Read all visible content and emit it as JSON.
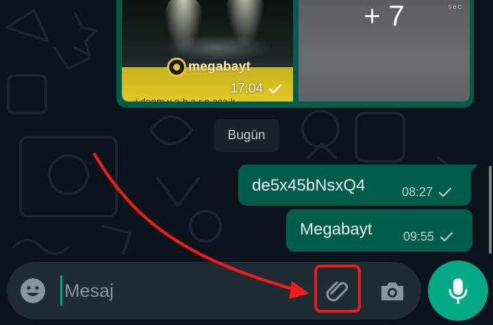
{
  "chat": {
    "album": {
      "brand_text": "megabayt",
      "caption_snippet": "i dənm y ə h ə r n əcə k",
      "time": "17:04",
      "more_count_label": "+ 7",
      "corner_note": "5:6 C"
    },
    "date_separator": "Bugün",
    "messages": [
      {
        "text": "de5x45bNsxQ4",
        "time": "08:27",
        "status_icon": "single-check-icon"
      },
      {
        "text": "Megabayt",
        "time": "09:55",
        "status_icon": "single-check-icon"
      }
    ]
  },
  "composer": {
    "placeholder": "Mesaj",
    "value": "",
    "emoji_icon": "emoji-icon",
    "attach_icon": "paperclip-icon",
    "camera_icon": "camera-icon",
    "mic_icon": "microphone-icon"
  },
  "annotation": {
    "highlight_color": "#ee1c1c",
    "arrow_color": "#ee1c1c",
    "target": "attach-button"
  },
  "colors": {
    "background": "#0b141a",
    "outgoing_bubble": "#005c4b",
    "accent": "#00a884",
    "composer": "#1f2c33"
  }
}
